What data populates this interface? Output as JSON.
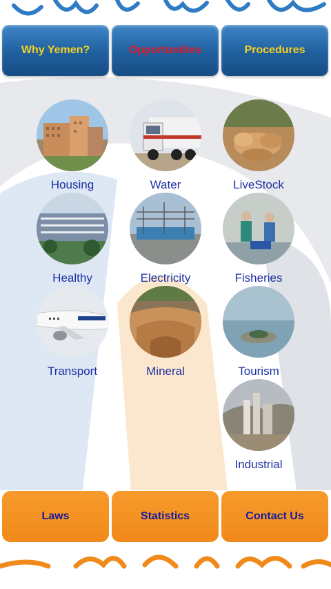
{
  "top_tabs": [
    {
      "label": "Why Yemen?"
    },
    {
      "label": "Opportunities"
    },
    {
      "label": "Procedures"
    }
  ],
  "sectors": [
    {
      "label": "Housing",
      "icon": "housing-photo"
    },
    {
      "label": "Water",
      "icon": "water-truck-photo"
    },
    {
      "label": "LiveStock",
      "icon": "camels-photo"
    },
    {
      "label": "Healthy",
      "icon": "hospital-photo"
    },
    {
      "label": "Electricity",
      "icon": "power-station-photo"
    },
    {
      "label": "Fisheries",
      "icon": "fish-market-photo"
    },
    {
      "label": "Transport",
      "icon": "airplane-photo"
    },
    {
      "label": "Mineral",
      "icon": "mine-photo"
    },
    {
      "label": "Tourism",
      "icon": "island-photo"
    },
    {
      "label": "Industrial",
      "icon": "factory-photo"
    }
  ],
  "bottom_buttons": [
    {
      "label": "Laws"
    },
    {
      "label": "Statistics"
    },
    {
      "label": "Contact Us"
    }
  ],
  "colors": {
    "tab_blue": "#1f5f9e",
    "tab_yellow_text": "#f6d21e",
    "tab_active_red_text": "#e4161f",
    "label_blue": "#1c2fa3",
    "button_orange": "#f08a1a",
    "button_text": "#151c9c"
  }
}
